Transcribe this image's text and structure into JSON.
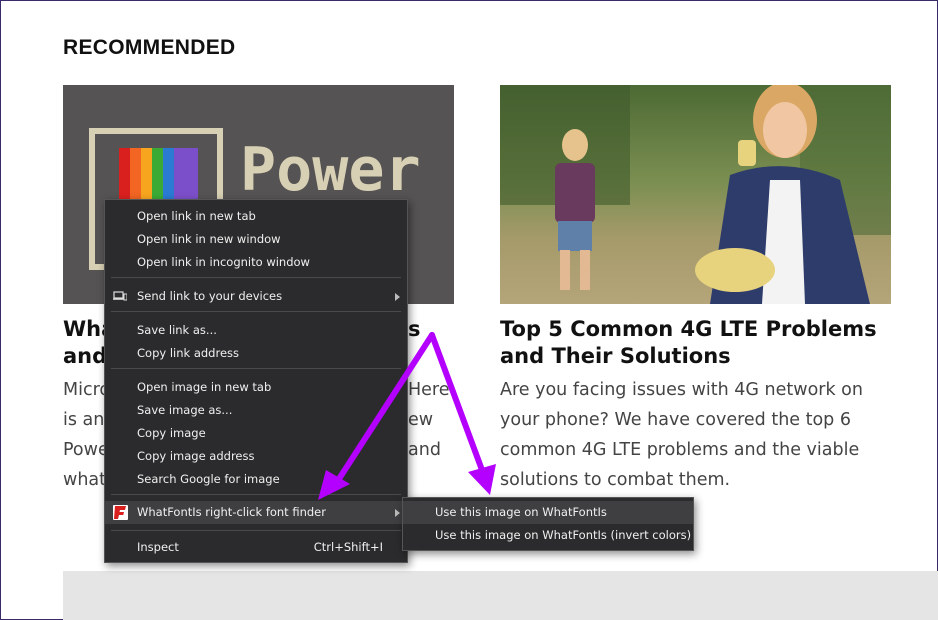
{
  "section": {
    "title": "RECOMMENDED"
  },
  "cards": [
    {
      "image_text": "Power",
      "title_lines": [
        "What",
        "and"
      ],
      "title_right": [
        "s",
        ""
      ],
      "desc_lines": [
        "Micro",
        "is an",
        "Powe",
        "what"
      ],
      "desc_right": [
        "Here",
        "ew",
        "and",
        ""
      ]
    },
    {
      "title_lines": [
        "Top 5 Common 4G LTE Problems",
        "and Their Solutions"
      ],
      "desc_lines": [
        "Are you facing issues with 4G network on",
        "your phone? We have covered the top 6",
        "common 4G LTE problems and the viable",
        "solutions to combat them."
      ]
    }
  ],
  "context_menu": {
    "items": [
      {
        "label": "Open link in new tab"
      },
      {
        "label": "Open link in new window"
      },
      {
        "label": "Open link in incognito window"
      },
      {
        "label": "Send link to your devices"
      },
      {
        "label": "Save link as..."
      },
      {
        "label": "Copy link address"
      },
      {
        "label": "Open image in new tab"
      },
      {
        "label": "Save image as..."
      },
      {
        "label": "Copy image"
      },
      {
        "label": "Copy image address"
      },
      {
        "label": "Search Google for image"
      },
      {
        "label": "WhatFontIs right-click font finder"
      },
      {
        "label": "Inspect",
        "shortcut": "Ctrl+Shift+I"
      }
    ]
  },
  "submenu": {
    "items": [
      {
        "label": "Use this image on WhatFontIs"
      },
      {
        "label": "Use this image on WhatFontIs (invert colors)"
      }
    ]
  },
  "colors": {
    "annotation_arrow": "#b400ff",
    "menu_bg": "#2b2b2d",
    "whatfontis_red": "#d9201f"
  }
}
